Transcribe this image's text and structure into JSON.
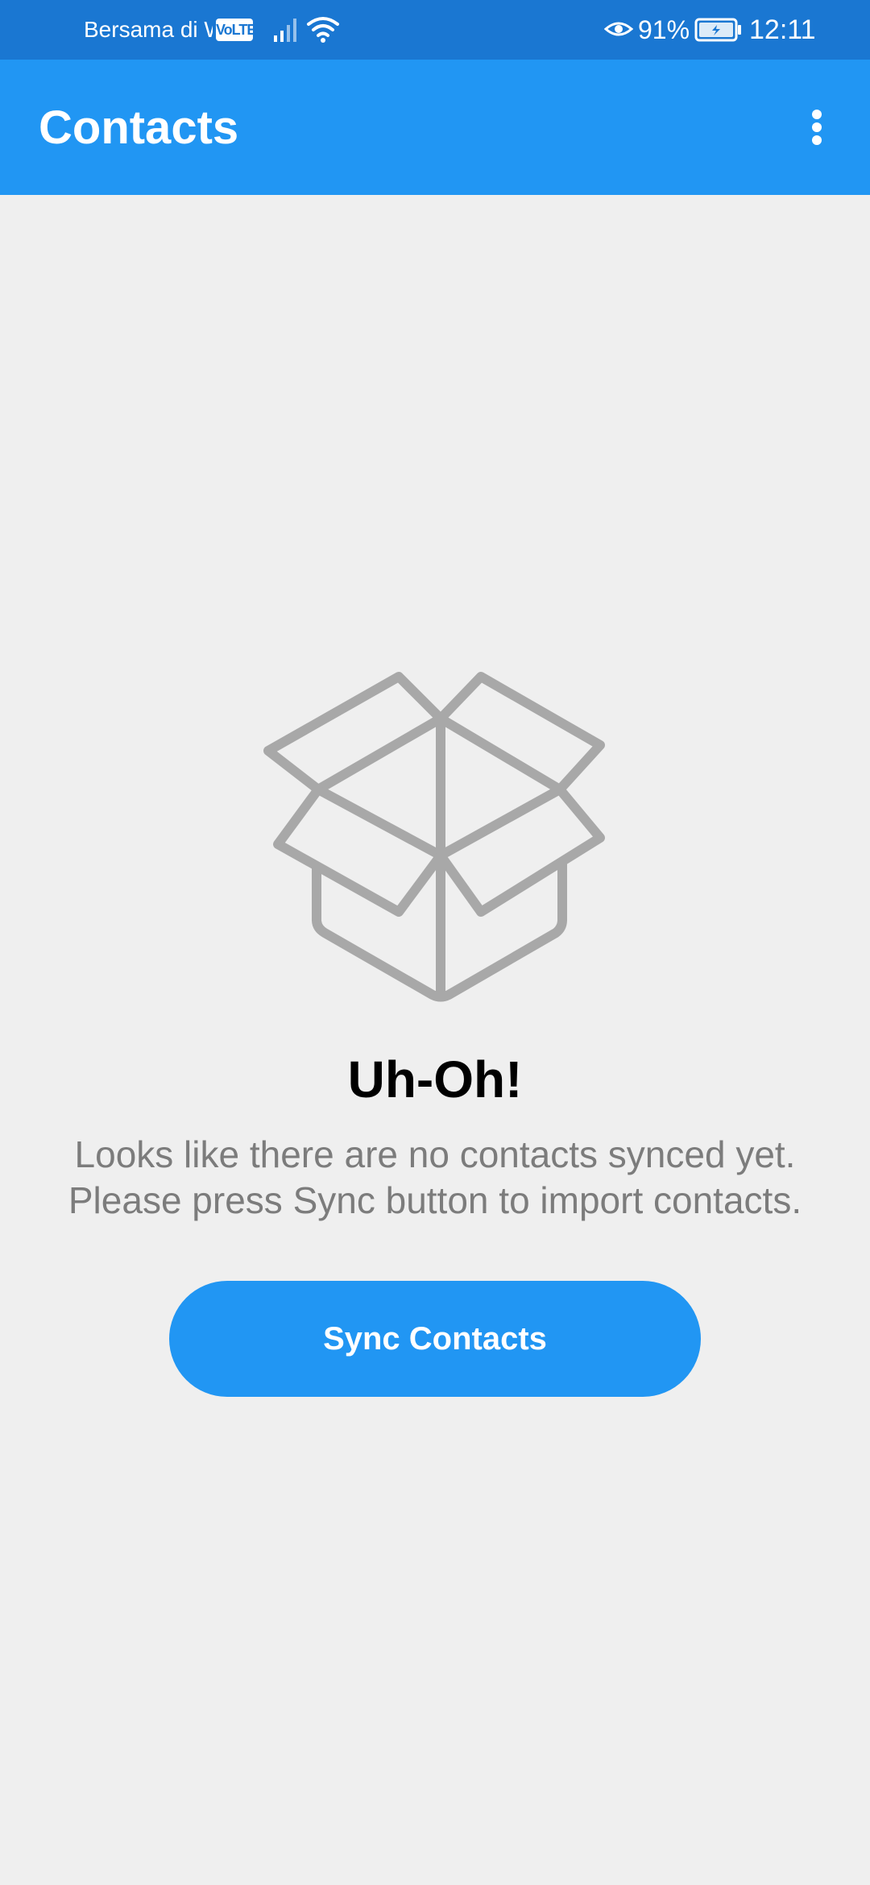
{
  "status_bar": {
    "carrier": "Bersama di Wi",
    "volte": "VoLTE",
    "battery_percent": "91%",
    "time": "12:11",
    "icons": [
      "signal-icon",
      "wifi-icon",
      "eye-icon",
      "battery-charging-icon"
    ]
  },
  "app_bar": {
    "title": "Contacts",
    "menu_icon": "more-vert-icon"
  },
  "empty_state": {
    "icon": "open-box-icon",
    "heading": "Uh-Oh!",
    "message_line1": "Looks like there are no contacts synced yet.",
    "message_line2": "Please press Sync button to import contacts.",
    "button_label": "Sync Contacts"
  },
  "colors": {
    "status_bar": "#1a77d2",
    "primary": "#2196f3",
    "background": "#efefef",
    "icon_gray": "#a8a8a8",
    "message_text": "#7c7c7c"
  }
}
